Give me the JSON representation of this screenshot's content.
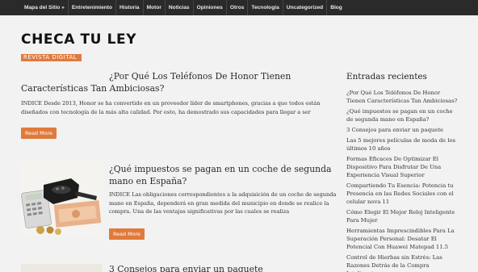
{
  "nav": {
    "items": [
      "Mapa del Sitio »",
      "Entretenimiento",
      "Historia",
      "Motor",
      "Noticias",
      "Opiniones",
      "Otros",
      "Tecnología",
      "Uncategorized",
      "Blog"
    ]
  },
  "site": {
    "title": "CHECA TU LEY",
    "tagline": "REVISTA DIGITAL"
  },
  "posts": [
    {
      "title": "¿Por Qué Los Teléfonos De Honor Tienen Características Tan Ambiciosas?",
      "excerpt": "INDICE   Desde 2013, Honor se ha convertido en un proveedor líder de smartphones, gracias a que todos están diseñados con tecnología de la más alta calidad. Por esto, ha demostrado sus capacidades para llegar a ser",
      "read_more": "Read More"
    },
    {
      "title": "¿Qué impuestos se pagan en un coche de segunda mano en España?",
      "excerpt": "INDICE Las obligaciones correspondientes a la adquisición de un coche de segunda mano en España, dependerá en gran medida del municipio en donde se realice la compra.  Una de las ventajas significativas por las cuales se realiza",
      "read_more": "Read More"
    },
    {
      "title": "3 Consejos para enviar un paquete"
    }
  ],
  "sidebar": {
    "title": "Entradas recientes",
    "items": [
      "¿Por Qué Los Teléfonos De Honor Tienen Características Tan Ambiciosas?",
      "¿Qué impuestos se pagan en un coche de segunda mano en España?",
      "3 Consejos para enviar un paquete",
      "Las 5 mejores películas de moda de los últimos 10 años",
      "Formas Eficaces De Optimizar El Dispositivo Para Disfrutar De Una Experiencia Visual Superior",
      "Compartiendo Tu Esencia: Potencia tu Presencia en las Redes Sociales con el celular nova 11",
      "Cómo Elegir El Mejor Reloj Inteligente Para Mujer",
      "Herramientas Imprescindibles Para La Superación Personal: Desatar El Potencial Con Huawei Matepad 11.5",
      "Control de Hierbas sin Estrés: Las Razones Detrás de la Compra Inteligente"
    ]
  }
}
